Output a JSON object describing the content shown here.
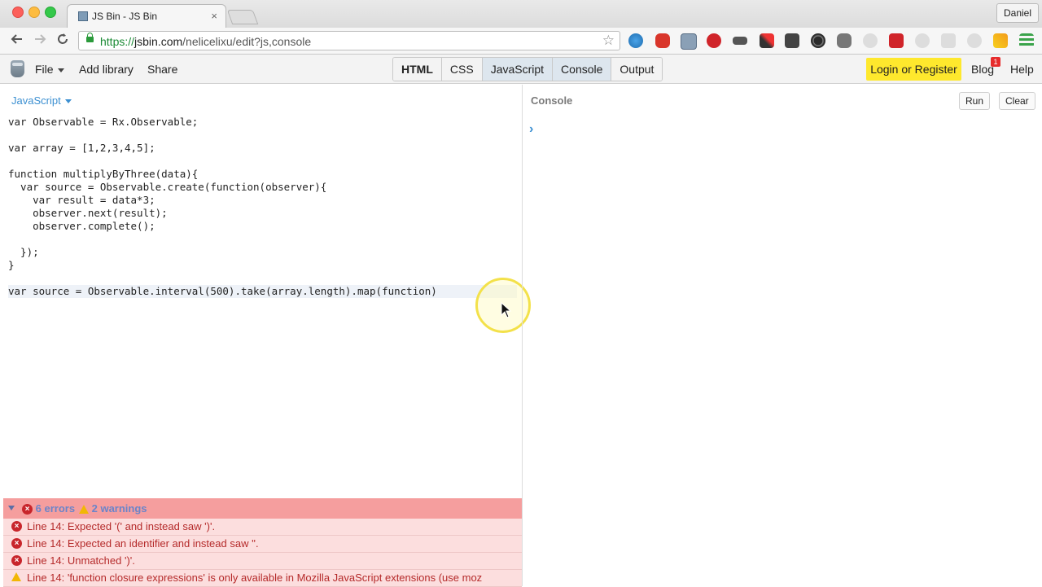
{
  "browser": {
    "tab_title": "JS Bin - JS Bin",
    "tab_close": "×",
    "profile_name": "Daniel",
    "url_scheme": "https://",
    "url_host": "jsbin.com",
    "url_path": "/nelicelixu/edit?js,console"
  },
  "jsbin": {
    "menu": {
      "file": "File",
      "add_library": "Add library",
      "share": "Share"
    },
    "panels": [
      "HTML",
      "CSS",
      "JavaScript",
      "Console",
      "Output"
    ],
    "login": "Login or Register",
    "blog": "Blog",
    "blog_badge": "1",
    "help": "Help"
  },
  "editor": {
    "language": "JavaScript",
    "code_lines": [
      "var Observable = Rx.Observable;",
      "",
      "var array = [1,2,3,4,5];",
      "",
      "function multiplyByThree(data){",
      "  var source = Observable.create(function(observer){",
      "    var result = data*3;",
      "    observer.next(result);",
      "    observer.complete();",
      "",
      "  });",
      "}",
      "",
      "var source = Observable.interval(500).take(array.length).map(function)"
    ]
  },
  "console": {
    "title": "Console",
    "run": "Run",
    "clear": "Clear",
    "prompt": "›"
  },
  "lint": {
    "errors_label": "6 errors",
    "warnings_label": "2 warnings",
    "messages": [
      {
        "type": "error",
        "text": "Line 14: Expected '(' and instead saw ')'."
      },
      {
        "type": "error",
        "text": "Line 14: Expected an identifier and instead saw ''."
      },
      {
        "type": "error",
        "text": "Line 14: Unmatched ')'."
      },
      {
        "type": "warning",
        "text": "Line 14: 'function closure expressions' is only available in Mozilla JavaScript extensions (use moz"
      }
    ]
  },
  "colors": {
    "login_bg": "#fee82d",
    "error_bar": "#f59e9e",
    "accent_blue": "#3b8fd1"
  }
}
